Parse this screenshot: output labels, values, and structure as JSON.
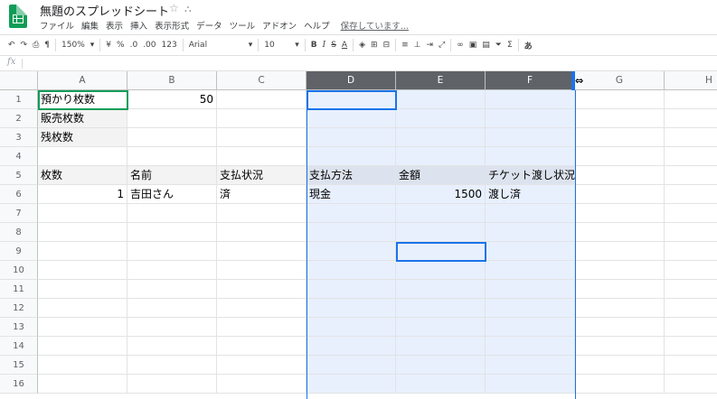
{
  "app": {
    "title": "無題のスプレッドシート",
    "saving_status": "保存しています...",
    "menu": [
      "ファイル",
      "編集",
      "表示",
      "挿入",
      "表示形式",
      "データ",
      "ツール",
      "アドオン",
      "ヘルプ"
    ]
  },
  "toolbar": {
    "zoom": "150%",
    "currency": "¥",
    "percent": "%",
    "dec_decrease": ".0",
    "dec_increase": ".00",
    "format_more": "123",
    "font": "Arial",
    "font_size": "10",
    "bold": "B",
    "italic": "I",
    "strike": "S",
    "text_color": "A",
    "input_tools": "あ"
  },
  "formula_bar": {
    "fx_label": "fx",
    "value": ""
  },
  "columns": [
    "A",
    "B",
    "C",
    "D",
    "E",
    "F",
    "G",
    "H"
  ],
  "rows": [
    "1",
    "2",
    "3",
    "4",
    "5",
    "6",
    "7",
    "8",
    "9",
    "10",
    "11",
    "12",
    "13",
    "14",
    "15",
    "16"
  ],
  "cells": {
    "A1": "預かり枚数",
    "B1": "50",
    "A2": "販売枚数",
    "A3": "残枚数",
    "A5": "枚数",
    "B5": "名前",
    "C5": "支払状況",
    "D5": "支払方法",
    "E5": "金額",
    "F5": "チケット渡し状況",
    "A6": "1",
    "B6": "吉田さん",
    "C6": "済",
    "D6": "現金",
    "E6": "1500",
    "F6": "渡し済"
  },
  "colors": {
    "accent": "#1a73e8",
    "sheets_green": "#0f9d58",
    "selected_column_fill": "#e8f0fe",
    "selected_header": "#5f6368"
  }
}
